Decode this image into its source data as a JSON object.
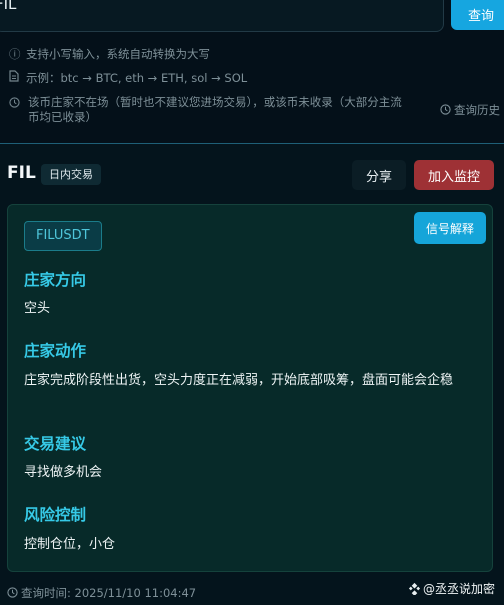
{
  "search": {
    "value": "FIL",
    "button_label": "查询"
  },
  "hints": [
    {
      "icon": "info-icon",
      "text": "支持小写输入，系统自动转换为大写"
    },
    {
      "icon": "document-icon",
      "text": "示例：btc → BTC, eth → ETH, sol → SOL"
    },
    {
      "icon": "clock-icon",
      "line1": "该币庄家不在场（暂时也不建议您进场交易），或该币未收录（大部分主流",
      "line2": "币均已收录）"
    }
  ],
  "history_label": "查询历史",
  "result": {
    "coin": "FIL",
    "tag": "日内交易",
    "share_label": "分享",
    "monitor_label": "加入监控",
    "symbol": "FILUSDT",
    "explain_label": "信号解释",
    "sections": [
      {
        "title": "庄家方向",
        "text": "空头"
      },
      {
        "title": "庄家动作",
        "text": "庄家完成阶段性出货，空头力度正在减弱，开始底部吸筹，盘面可能会企稳"
      },
      {
        "title": "交易建议",
        "text": "寻找做多机会"
      },
      {
        "title": "风险控制",
        "text": "控制仓位，小仓"
      }
    ]
  },
  "footer": {
    "query_time": "查询时间: 2025/11/10 11:04:47",
    "watermark": "@丞丞说加密"
  },
  "colors": {
    "accent": "#16a6e0",
    "section_title": "#36c9e6",
    "monitor_button": "#9e3135",
    "card_bg": "#072a29"
  }
}
